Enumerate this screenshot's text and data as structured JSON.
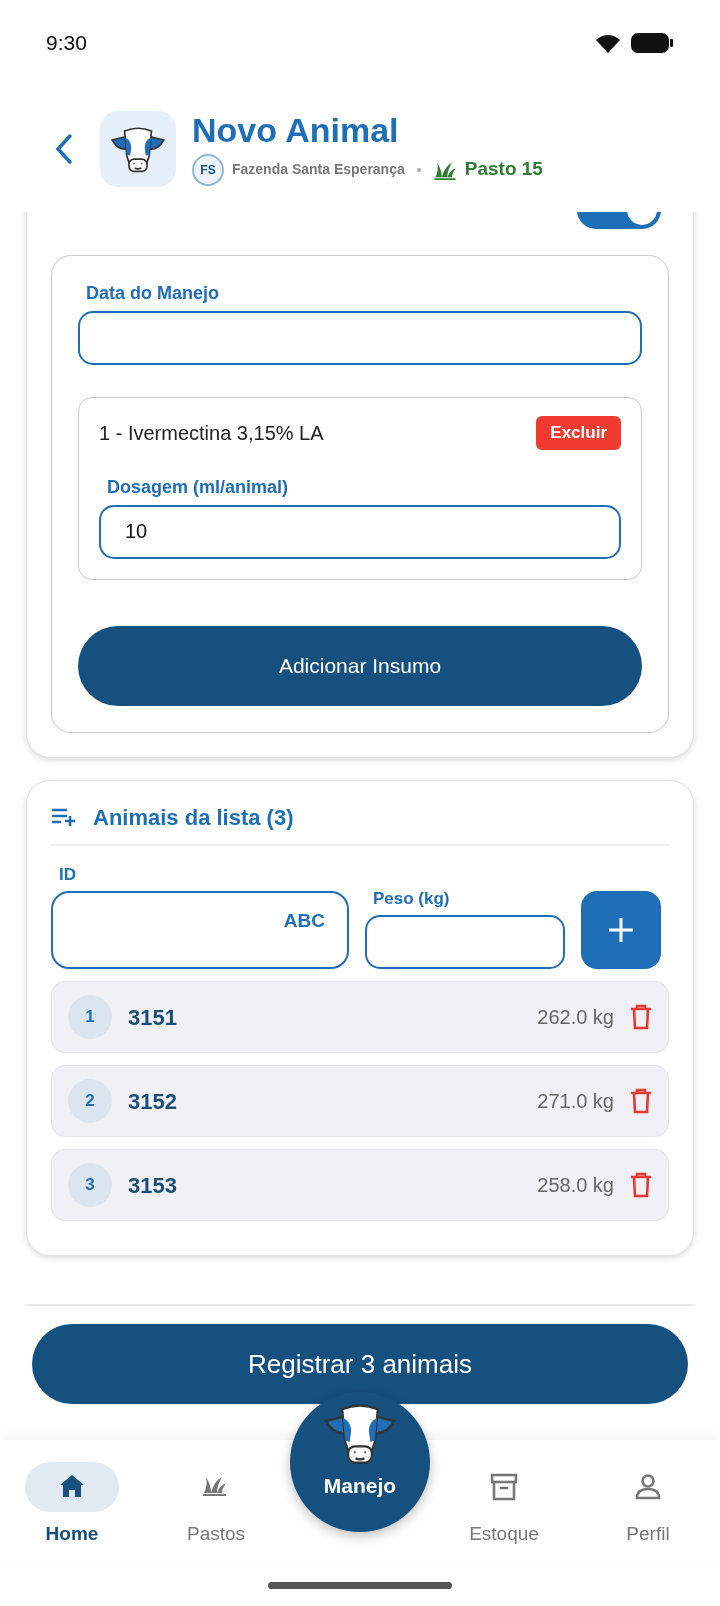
{
  "status_bar": {
    "time": "9:30"
  },
  "header": {
    "title": "Novo Animal",
    "farm_initials": "FS",
    "farm": "Fazenda Santa Esperança",
    "pasture": "Pasto 15"
  },
  "manejo_card": {
    "switch": {
      "on": true
    },
    "date_field": {
      "label": "Data do Manejo"
    },
    "insumos": [
      {
        "name": "1 - Ivermectina 3,15% LA",
        "delete_label": "Excluir",
        "dose_label": "Dosagem (ml/animal)",
        "dose_value": "10"
      }
    ],
    "add_button": "Adicionar Insumo"
  },
  "animals_card": {
    "title": "Animais da lista (3)",
    "id_field": {
      "label": "ID",
      "keyboard_hint": "ABC"
    },
    "weight_field": {
      "label": "Peso (kg)"
    },
    "animals": [
      {
        "index": "1",
        "id": "3151",
        "weight": "262.0 kg"
      },
      {
        "index": "2",
        "id": "3152",
        "weight": "271.0 kg"
      },
      {
        "index": "3",
        "id": "3153",
        "weight": "258.0 kg"
      }
    ]
  },
  "submit_button": "Registrar 3 animais",
  "bottom_nav": {
    "items": [
      {
        "label": "Home",
        "kind": "tab",
        "selected": true
      },
      {
        "label": "Pastos",
        "kind": "tab",
        "selected": false
      },
      {
        "label": "Manejo",
        "kind": "center",
        "selected": false
      },
      {
        "label": "Estoque",
        "kind": "tab",
        "selected": false
      },
      {
        "label": "Perfil",
        "kind": "tab",
        "selected": false
      }
    ]
  }
}
